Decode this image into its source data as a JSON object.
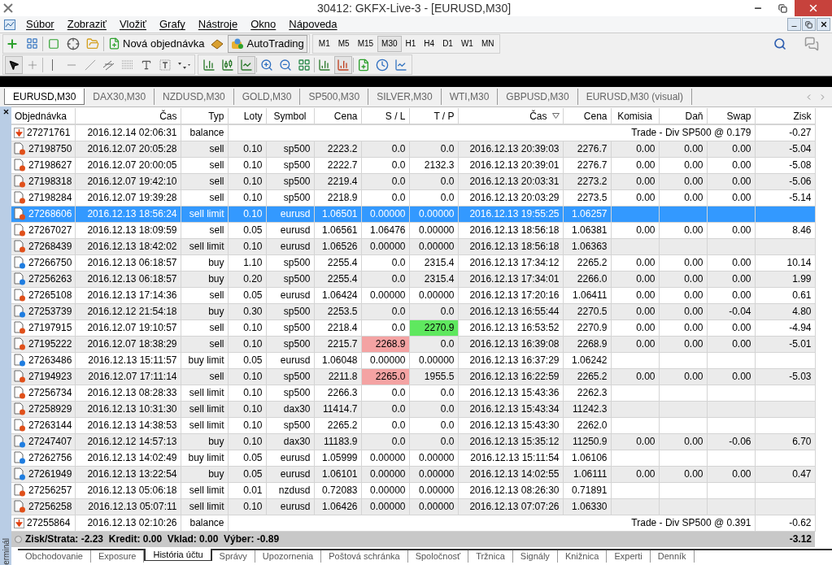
{
  "window": {
    "title": "30412: GKFX-Live-3 - [EURUSD,M30]"
  },
  "menu": [
    "Súbor",
    "Zobraziť",
    "Vložiť",
    "Grafy",
    "Nástroje",
    "Okno",
    "Nápoveda"
  ],
  "toolbar": {
    "new_order": "Nová objednávka",
    "autotrading": "AutoTrading",
    "timeframes": [
      {
        "label": "M1",
        "selected": false
      },
      {
        "label": "M5",
        "selected": false
      },
      {
        "label": "M15",
        "selected": false
      },
      {
        "label": "M30",
        "selected": true
      },
      {
        "label": "H1",
        "selected": false
      },
      {
        "label": "H4",
        "selected": false
      },
      {
        "label": "D1",
        "selected": false
      },
      {
        "label": "W1",
        "selected": false
      },
      {
        "label": "MN",
        "selected": false
      }
    ]
  },
  "chart_tabs": [
    {
      "label": "EURUSD,M30",
      "selected": true
    },
    {
      "label": "DAX30,M30",
      "selected": false
    },
    {
      "label": "NZDUSD,M30",
      "selected": false
    },
    {
      "label": "GOLD,M30",
      "selected": false
    },
    {
      "label": "SP500,M30",
      "selected": false
    },
    {
      "label": "SILVER,M30",
      "selected": false
    },
    {
      "label": "WTI,M30",
      "selected": false
    },
    {
      "label": "GBPUSD,M30",
      "selected": false
    },
    {
      "label": "EURUSD,M30 (visual)",
      "selected": false
    }
  ],
  "terminal": {
    "side_label": "erminál",
    "columns": [
      {
        "label": "Objednávka",
        "sorted": false
      },
      {
        "label": "Čas",
        "sorted": false
      },
      {
        "label": "Typ",
        "sorted": false
      },
      {
        "label": "Loty",
        "sorted": false
      },
      {
        "label": "Symbol",
        "sorted": false
      },
      {
        "label": "Cena",
        "sorted": false
      },
      {
        "label": "S / L",
        "sorted": false
      },
      {
        "label": "T / P",
        "sorted": false
      },
      {
        "label": "Čas",
        "sorted": true
      },
      {
        "label": "Cena",
        "sorted": false
      },
      {
        "label": "Komisia",
        "sorted": false
      },
      {
        "label": "Daň",
        "sorted": false
      },
      {
        "label": "Swap",
        "sorted": false
      },
      {
        "label": "Zisk",
        "sorted": false
      }
    ],
    "rows": [
      {
        "kind": "balance",
        "selected": false,
        "order": "27271761",
        "time": "2016.12.14 02:06:31",
        "type": "balance",
        "comment": "Trade - Div SP500 @ 0.179",
        "profit": "-0.27"
      },
      {
        "kind": "order",
        "selected": false,
        "buy": false,
        "sl_hit": false,
        "tp_hit": false,
        "order": "27198750",
        "time": "2016.12.07 20:05:28",
        "type": "sell",
        "lots": "0.10",
        "symbol": "sp500",
        "price": "2223.2",
        "sl": "0.0",
        "tp": "0.0",
        "close_time": "2016.12.13 20:39:03",
        "close_price": "2276.7",
        "commission": "0.00",
        "tax": "0.00",
        "swap": "0.00",
        "profit": "-5.04"
      },
      {
        "kind": "order",
        "selected": false,
        "buy": false,
        "sl_hit": false,
        "tp_hit": false,
        "order": "27198627",
        "time": "2016.12.07 20:00:05",
        "type": "sell",
        "lots": "0.10",
        "symbol": "sp500",
        "price": "2222.7",
        "sl": "0.0",
        "tp": "2132.3",
        "close_time": "2016.12.13 20:39:01",
        "close_price": "2276.7",
        "commission": "0.00",
        "tax": "0.00",
        "swap": "0.00",
        "profit": "-5.08"
      },
      {
        "kind": "order",
        "selected": false,
        "buy": false,
        "sl_hit": false,
        "tp_hit": false,
        "order": "27198318",
        "time": "2016.12.07 19:42:10",
        "type": "sell",
        "lots": "0.10",
        "symbol": "sp500",
        "price": "2219.4",
        "sl": "0.0",
        "tp": "0.0",
        "close_time": "2016.12.13 20:03:31",
        "close_price": "2273.2",
        "commission": "0.00",
        "tax": "0.00",
        "swap": "0.00",
        "profit": "-5.06"
      },
      {
        "kind": "order",
        "selected": false,
        "buy": false,
        "sl_hit": false,
        "tp_hit": false,
        "order": "27198284",
        "time": "2016.12.07 19:39:28",
        "type": "sell",
        "lots": "0.10",
        "symbol": "sp500",
        "price": "2218.9",
        "sl": "0.0",
        "tp": "0.0",
        "close_time": "2016.12.13 20:03:29",
        "close_price": "2273.5",
        "commission": "0.00",
        "tax": "0.00",
        "swap": "0.00",
        "profit": "-5.14"
      },
      {
        "kind": "order",
        "selected": true,
        "buy": false,
        "sl_hit": false,
        "tp_hit": false,
        "order": "27268606",
        "time": "2016.12.13 18:56:24",
        "type": "sell limit",
        "lots": "0.10",
        "symbol": "eurusd",
        "price": "1.06501",
        "sl": "0.00000",
        "tp": "0.00000",
        "close_time": "2016.12.13 19:55:25",
        "close_price": "1.06257"
      },
      {
        "kind": "order",
        "selected": false,
        "buy": false,
        "sl_hit": false,
        "tp_hit": false,
        "order": "27267027",
        "time": "2016.12.13 18:09:59",
        "type": "sell",
        "lots": "0.05",
        "symbol": "eurusd",
        "price": "1.06561",
        "sl": "1.06476",
        "tp": "0.00000",
        "close_time": "2016.12.13 18:56:18",
        "close_price": "1.06381",
        "commission": "0.00",
        "tax": "0.00",
        "swap": "0.00",
        "profit": "8.46"
      },
      {
        "kind": "order",
        "selected": false,
        "buy": false,
        "sl_hit": false,
        "tp_hit": false,
        "order": "27268439",
        "time": "2016.12.13 18:42:02",
        "type": "sell limit",
        "lots": "0.10",
        "symbol": "eurusd",
        "price": "1.06526",
        "sl": "0.00000",
        "tp": "0.00000",
        "close_time": "2016.12.13 18:56:18",
        "close_price": "1.06363"
      },
      {
        "kind": "order",
        "selected": false,
        "buy": true,
        "sl_hit": false,
        "tp_hit": false,
        "order": "27266750",
        "time": "2016.12.13 06:18:57",
        "type": "buy",
        "lots": "1.10",
        "symbol": "sp500",
        "price": "2255.4",
        "sl": "0.0",
        "tp": "2315.4",
        "close_time": "2016.12.13 17:34:12",
        "close_price": "2265.2",
        "commission": "0.00",
        "tax": "0.00",
        "swap": "0.00",
        "profit": "10.14"
      },
      {
        "kind": "order",
        "selected": false,
        "buy": true,
        "sl_hit": false,
        "tp_hit": false,
        "order": "27256263",
        "time": "2016.12.13 06:18:57",
        "type": "buy",
        "lots": "0.20",
        "symbol": "sp500",
        "price": "2255.4",
        "sl": "0.0",
        "tp": "2315.4",
        "close_time": "2016.12.13 17:34:01",
        "close_price": "2266.0",
        "commission": "0.00",
        "tax": "0.00",
        "swap": "0.00",
        "profit": "1.99"
      },
      {
        "kind": "order",
        "selected": false,
        "buy": false,
        "sl_hit": false,
        "tp_hit": false,
        "order": "27265108",
        "time": "2016.12.13 17:14:36",
        "type": "sell",
        "lots": "0.05",
        "symbol": "eurusd",
        "price": "1.06424",
        "sl": "0.00000",
        "tp": "0.00000",
        "close_time": "2016.12.13 17:20:16",
        "close_price": "1.06411",
        "commission": "0.00",
        "tax": "0.00",
        "swap": "0.00",
        "profit": "0.61"
      },
      {
        "kind": "order",
        "selected": false,
        "buy": true,
        "sl_hit": false,
        "tp_hit": false,
        "order": "27253739",
        "time": "2016.12.12 21:54:18",
        "type": "buy",
        "lots": "0.30",
        "symbol": "sp500",
        "price": "2253.5",
        "sl": "0.0",
        "tp": "0.0",
        "close_time": "2016.12.13 16:55:44",
        "close_price": "2270.5",
        "commission": "0.00",
        "tax": "0.00",
        "swap": "-0.04",
        "profit": "4.80"
      },
      {
        "kind": "order",
        "selected": false,
        "buy": false,
        "sl_hit": false,
        "tp_hit": true,
        "order": "27197915",
        "time": "2016.12.07 19:10:57",
        "type": "sell",
        "lots": "0.10",
        "symbol": "sp500",
        "price": "2218.4",
        "sl": "0.0",
        "tp": "2270.9",
        "close_time": "2016.12.13 16:53:52",
        "close_price": "2270.9",
        "commission": "0.00",
        "tax": "0.00",
        "swap": "0.00",
        "profit": "-4.94"
      },
      {
        "kind": "order",
        "selected": false,
        "buy": false,
        "sl_hit": true,
        "tp_hit": false,
        "order": "27195222",
        "time": "2016.12.07 18:38:29",
        "type": "sell",
        "lots": "0.10",
        "symbol": "sp500",
        "price": "2215.7",
        "sl": "2268.9",
        "tp": "0.0",
        "close_time": "2016.12.13 16:39:08",
        "close_price": "2268.9",
        "commission": "0.00",
        "tax": "0.00",
        "swap": "0.00",
        "profit": "-5.01"
      },
      {
        "kind": "order",
        "selected": false,
        "buy": true,
        "sl_hit": false,
        "tp_hit": false,
        "order": "27263486",
        "time": "2016.12.13 15:11:57",
        "type": "buy limit",
        "lots": "0.05",
        "symbol": "eurusd",
        "price": "1.06048",
        "sl": "0.00000",
        "tp": "0.00000",
        "close_time": "2016.12.13 16:37:29",
        "close_price": "1.06242"
      },
      {
        "kind": "order",
        "selected": false,
        "buy": false,
        "sl_hit": true,
        "tp_hit": false,
        "order": "27194923",
        "time": "2016.12.07 17:11:14",
        "type": "sell",
        "lots": "0.10",
        "symbol": "sp500",
        "price": "2211.8",
        "sl": "2265.0",
        "tp": "1955.5",
        "close_time": "2016.12.13 16:22:59",
        "close_price": "2265.2",
        "commission": "0.00",
        "tax": "0.00",
        "swap": "0.00",
        "profit": "-5.03"
      },
      {
        "kind": "order",
        "selected": false,
        "buy": false,
        "sl_hit": false,
        "tp_hit": false,
        "order": "27256734",
        "time": "2016.12.13 08:28:33",
        "type": "sell limit",
        "lots": "0.10",
        "symbol": "sp500",
        "price": "2266.3",
        "sl": "0.0",
        "tp": "0.0",
        "close_time": "2016.12.13 15:43:36",
        "close_price": "2262.3"
      },
      {
        "kind": "order",
        "selected": false,
        "buy": false,
        "sl_hit": false,
        "tp_hit": false,
        "order": "27258929",
        "time": "2016.12.13 10:31:30",
        "type": "sell limit",
        "lots": "0.10",
        "symbol": "dax30",
        "price": "11414.7",
        "sl": "0.0",
        "tp": "0.0",
        "close_time": "2016.12.13 15:43:34",
        "close_price": "11242.3"
      },
      {
        "kind": "order",
        "selected": false,
        "buy": false,
        "sl_hit": false,
        "tp_hit": false,
        "order": "27263144",
        "time": "2016.12.13 14:38:53",
        "type": "sell limit",
        "lots": "0.10",
        "symbol": "sp500",
        "price": "2265.2",
        "sl": "0.0",
        "tp": "0.0",
        "close_time": "2016.12.13 15:43:30",
        "close_price": "2262.0"
      },
      {
        "kind": "order",
        "selected": false,
        "buy": true,
        "sl_hit": false,
        "tp_hit": false,
        "order": "27247407",
        "time": "2016.12.12 14:57:13",
        "type": "buy",
        "lots": "0.10",
        "symbol": "dax30",
        "price": "11183.9",
        "sl": "0.0",
        "tp": "0.0",
        "close_time": "2016.12.13 15:35:12",
        "close_price": "11250.9",
        "commission": "0.00",
        "tax": "0.00",
        "swap": "-0.06",
        "profit": "6.70"
      },
      {
        "kind": "order",
        "selected": false,
        "buy": true,
        "sl_hit": false,
        "tp_hit": false,
        "order": "27262756",
        "time": "2016.12.13 14:02:49",
        "type": "buy limit",
        "lots": "0.05",
        "symbol": "eurusd",
        "price": "1.05999",
        "sl": "0.00000",
        "tp": "0.00000",
        "close_time": "2016.12.13 15:11:54",
        "close_price": "1.06106"
      },
      {
        "kind": "order",
        "selected": false,
        "buy": true,
        "sl_hit": false,
        "tp_hit": false,
        "order": "27261949",
        "time": "2016.12.13 13:22:54",
        "type": "buy",
        "lots": "0.05",
        "symbol": "eurusd",
        "price": "1.06101",
        "sl": "0.00000",
        "tp": "0.00000",
        "close_time": "2016.12.13 14:02:55",
        "close_price": "1.06111",
        "commission": "0.00",
        "tax": "0.00",
        "swap": "0.00",
        "profit": "0.47"
      },
      {
        "kind": "order",
        "selected": false,
        "buy": false,
        "sl_hit": false,
        "tp_hit": false,
        "order": "27256257",
        "time": "2016.12.13 05:06:18",
        "type": "sell limit",
        "lots": "0.01",
        "symbol": "nzdusd",
        "price": "0.72083",
        "sl": "0.00000",
        "tp": "0.00000",
        "close_time": "2016.12.13 08:26:30",
        "close_price": "0.71891"
      },
      {
        "kind": "order",
        "selected": false,
        "buy": false,
        "sl_hit": false,
        "tp_hit": false,
        "order": "27256258",
        "time": "2016.12.13 05:07:11",
        "type": "sell limit",
        "lots": "0.10",
        "symbol": "eurusd",
        "price": "1.06426",
        "sl": "0.00000",
        "tp": "0.00000",
        "close_time": "2016.12.13 07:07:26",
        "close_price": "1.06330"
      },
      {
        "kind": "balance",
        "selected": false,
        "order": "27255864",
        "time": "2016.12.13 02:10:26",
        "type": "balance",
        "comment": "Trade - Div SP500 @ 0.391",
        "profit": "-0.62"
      }
    ],
    "summary": {
      "text": "Zisk/Strata: -2.23  Kredit: 0.00  Vklad: 0.00  Výber: -0.89",
      "total": "-3.12"
    }
  },
  "bottom_tabs": [
    {
      "label": "Obchodovanie",
      "selected": false
    },
    {
      "label": "Exposure",
      "selected": false
    },
    {
      "label": "História účtu",
      "selected": true
    },
    {
      "label": "Správy",
      "selected": false
    },
    {
      "label": "Upozornenia",
      "selected": false
    },
    {
      "label": "Poštová schránka",
      "selected": false
    },
    {
      "label": "Spoločnosť",
      "selected": false
    },
    {
      "label": "Tržnica",
      "selected": false
    },
    {
      "label": "Signály",
      "selected": false
    },
    {
      "label": "Knižnica",
      "selected": false
    },
    {
      "label": "Experti",
      "selected": false
    },
    {
      "label": "Denník",
      "selected": false
    }
  ]
}
